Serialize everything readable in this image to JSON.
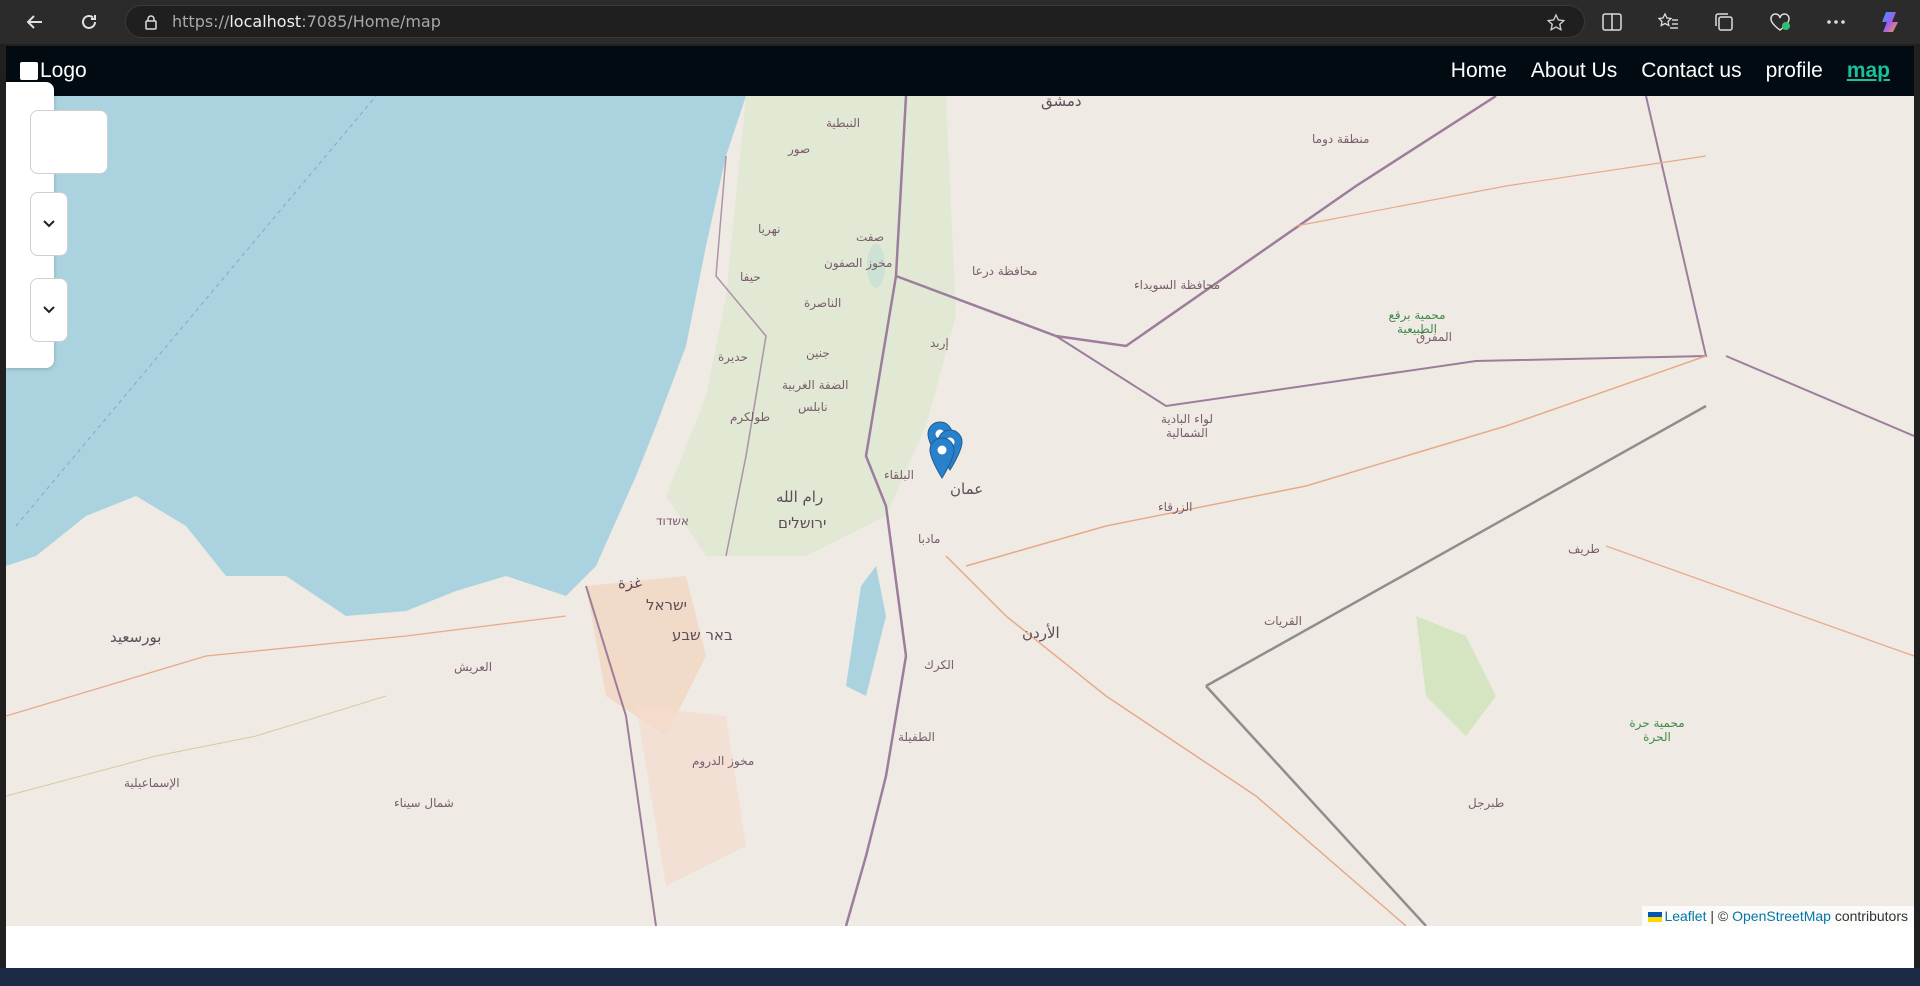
{
  "browser": {
    "url_prefix": "https://",
    "url_host": "localhost",
    "url_rest": ":7085/Home/map"
  },
  "navbar": {
    "logo_text": "Logo",
    "links": [
      {
        "label": "Home"
      },
      {
        "label": "About Us"
      },
      {
        "label": "Contact us"
      },
      {
        "label": "profile"
      },
      {
        "label": "map"
      }
    ]
  },
  "map": {
    "labels": [
      {
        "text": "دمشق"
      },
      {
        "text": "منطقة دوما"
      },
      {
        "text": "صور"
      },
      {
        "text": "النبطية"
      },
      {
        "text": "نهريا"
      },
      {
        "text": "صفت"
      },
      {
        "text": "حيفا"
      },
      {
        "text": "مخوز الصفون"
      },
      {
        "text": "الناصرة"
      },
      {
        "text": "محافظة درعا"
      },
      {
        "text": "محافظة السويداء"
      },
      {
        "text": "محمية برقع الطبيعية"
      },
      {
        "text": "المفرق"
      },
      {
        "text": "إربد"
      },
      {
        "text": "جنين"
      },
      {
        "text": "حديرة"
      },
      {
        "text": "طولكرم"
      },
      {
        "text": "نابلس"
      },
      {
        "text": "الضفة الغربية"
      },
      {
        "text": "لواء البادية الشمالية"
      },
      {
        "text": "الزرقاء"
      },
      {
        "text": "عمان"
      },
      {
        "text": "البلقاء"
      },
      {
        "text": "رام الله"
      },
      {
        "text": "ירושלים"
      },
      {
        "text": "אשדוד"
      },
      {
        "text": "غزة"
      },
      {
        "text": "ישראל"
      },
      {
        "text": "באר שבע"
      },
      {
        "text": "مادبا"
      },
      {
        "text": "الأردن"
      },
      {
        "text": "الكرك"
      },
      {
        "text": "الطفيلة"
      },
      {
        "text": "بورسعيد"
      },
      {
        "text": "العريش"
      },
      {
        "text": "شمال سيناء"
      },
      {
        "text": "الإسماعيلية"
      },
      {
        "text": "طريف"
      },
      {
        "text": "القريات"
      },
      {
        "text": "محمية حرة الحرة"
      },
      {
        "text": "طبرجل"
      },
      {
        "text": "مخوز الدروم"
      }
    ],
    "markers": [
      {
        "name": "marker-1"
      },
      {
        "name": "marker-2"
      },
      {
        "name": "marker-3"
      }
    ]
  },
  "attribution": {
    "leaflet": "Leaflet",
    "separator": " | © ",
    "osm": "OpenStreetMap",
    "contributors": " contributors"
  },
  "colors": {
    "navbar_bg": "#020a12",
    "active_link": "#1bbf9b",
    "sea": "#aad3df",
    "land": "#efebe4",
    "marker": "#2a81cb"
  }
}
